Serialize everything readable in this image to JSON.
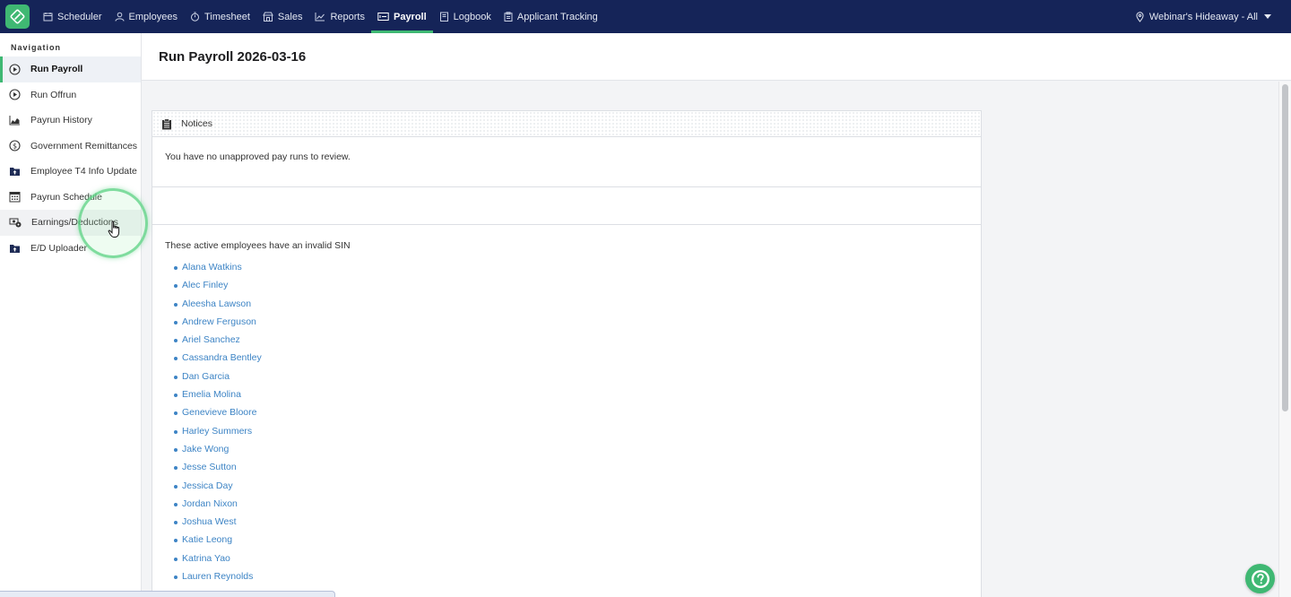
{
  "topnav": {
    "items": [
      {
        "label": "Scheduler",
        "icon": "calendar-icon",
        "active": false
      },
      {
        "label": "Employees",
        "icon": "person-icon",
        "active": false
      },
      {
        "label": "Timesheet",
        "icon": "stopwatch-icon",
        "active": false
      },
      {
        "label": "Sales",
        "icon": "shop-icon",
        "active": false
      },
      {
        "label": "Reports",
        "icon": "line-chart-icon",
        "active": false
      },
      {
        "label": "Payroll",
        "icon": "payroll-icon",
        "active": true
      },
      {
        "label": "Logbook",
        "icon": "book-icon",
        "active": false
      },
      {
        "label": "Applicant Tracking",
        "icon": "clipboard-icon",
        "active": false
      }
    ],
    "location": "Webinar's Hideaway - All"
  },
  "sidebar": {
    "heading": "Navigation",
    "items": [
      {
        "label": "Run Payroll",
        "icon": "play-circle-icon",
        "active": true
      },
      {
        "label": "Run Offrun",
        "icon": "play-circle-icon",
        "active": false
      },
      {
        "label": "Payrun History",
        "icon": "area-chart-icon",
        "active": false
      },
      {
        "label": "Government Remittances",
        "icon": "dollar-circle-icon",
        "active": false
      },
      {
        "label": "Employee T4 Info Update",
        "icon": "folder-upload-icon",
        "active": false
      },
      {
        "label": "Payrun Schedule",
        "icon": "calendar-grid-icon",
        "active": false
      },
      {
        "label": "Earnings/Deductions",
        "icon": "money-gear-icon",
        "active": false
      },
      {
        "label": "E/D Uploader",
        "icon": "folder-upload-icon",
        "active": false
      }
    ]
  },
  "page": {
    "title": "Run Payroll 2026-03-16"
  },
  "notices": {
    "header": "Notices",
    "message": "You have no unapproved pay runs to review.",
    "sin_heading": "These active employees have an invalid SIN",
    "employees": [
      "Alana Watkins",
      "Alec Finley",
      "Aleesha Lawson",
      "Andrew Ferguson",
      "Ariel Sanchez",
      "Cassandra Bentley",
      "Dan Garcia",
      "Emelia Molina",
      "Genevieve Bloore",
      "Harley Summers",
      "Jake Wong",
      "Jesse Sutton",
      "Jessica Day",
      "Jordan Nixon",
      "Joshua West",
      "Katie Leong",
      "Katrina Yao",
      "Lauren Reynolds"
    ]
  },
  "colors": {
    "topbar": "#152458",
    "accent": "#3fb873",
    "link": "#3d84c5"
  }
}
